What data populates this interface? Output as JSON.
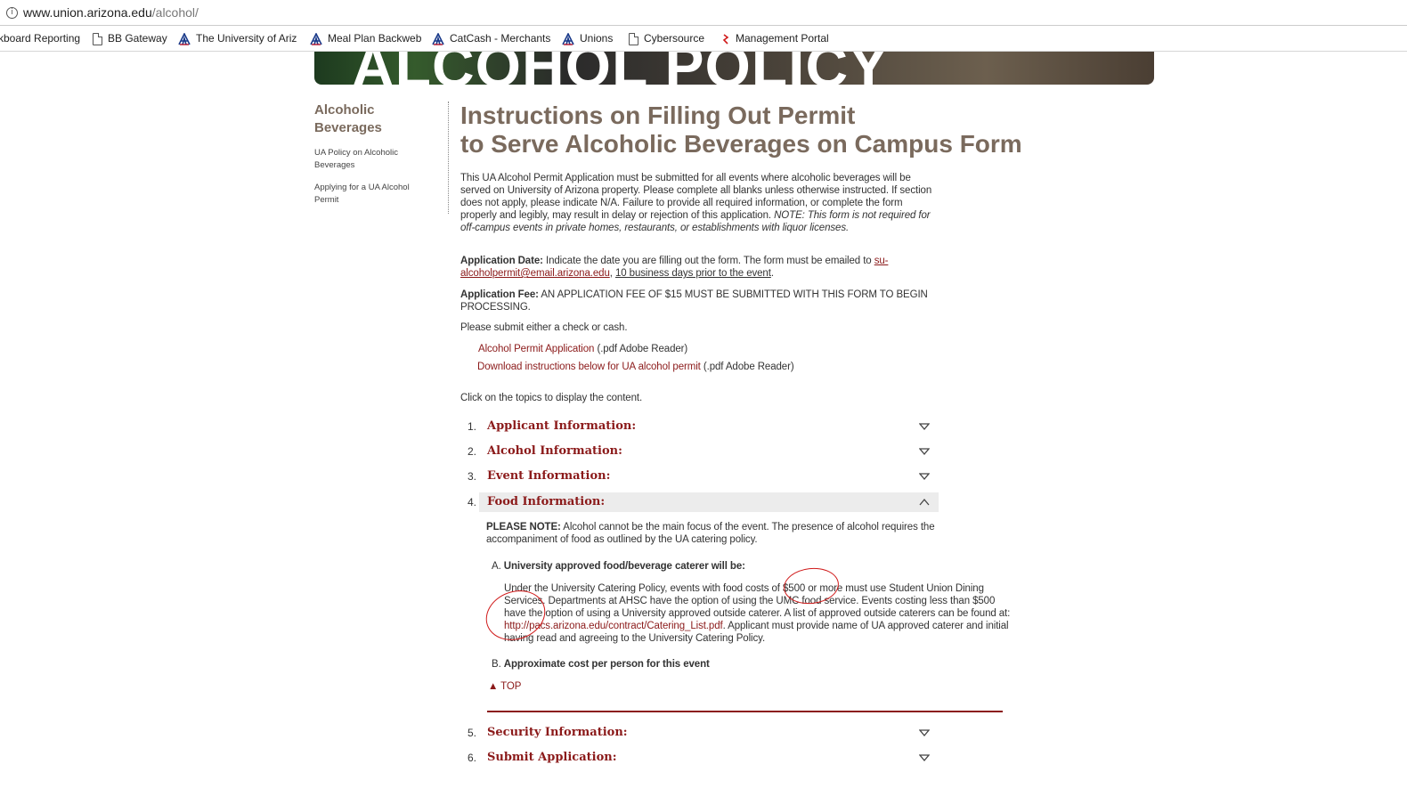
{
  "browser": {
    "url_host": "www.union.arizona.edu",
    "url_path": "/alcohol/",
    "bookmarks": [
      {
        "label": "kboard Reporting",
        "icon": "none"
      },
      {
        "label": "BB Gateway",
        "icon": "doc-icon"
      },
      {
        "label": "The University of Ariz",
        "icon": "ua-logo-icon"
      },
      {
        "label": "Meal Plan Backweb",
        "icon": "ua-logo-icon"
      },
      {
        "label": "CatCash - Merchants",
        "icon": "ua-logo-icon"
      },
      {
        "label": "Unions",
        "icon": "ua-logo-icon"
      },
      {
        "label": "Cybersource",
        "icon": "doc-icon"
      },
      {
        "label": "Management Portal",
        "icon": "management-icon"
      }
    ]
  },
  "banner": {
    "title": "ALCOHOL POLICY"
  },
  "sidebar": {
    "title": "Alcoholic Beverages",
    "links": [
      "UA Policy on Alcoholic Beverages",
      "Applying for a UA Alcohol Permit"
    ]
  },
  "main": {
    "title_line1": "Instructions on Filling Out Permit",
    "title_line2": "to Serve Alcoholic Beverages on Campus Form",
    "intro": "This UA Alcohol Permit Application must be submitted for all events where alcoholic beverages will be served on University of Arizona property. Please complete all blanks unless otherwise instructed. If section does not apply, please indicate N/A. Failure to provide all required information, or complete the form properly and legibly, may result in delay or rejection of this application.",
    "intro_note": "NOTE: This form is not required for off-campus events in private homes, restaurants, or establishments with liquor licenses.",
    "app_date_label": "Application Date:",
    "app_date_text": "Indicate the date you are filling out the form. The form must be emailed to",
    "app_date_email": "su-alcoholpermit@email.arizona.edu",
    "app_date_sep": ",",
    "app_date_deadline": "10 business days prior to the event",
    "app_date_end": ".",
    "app_fee_label": "Application Fee:",
    "app_fee_text": "AN APPLICATION FEE OF $15 MUST BE SUBMITTED WITH THIS FORM TO BEGIN PROCESSING.",
    "payment_text": "Please submit either a check or cash.",
    "downloads": [
      {
        "link": "Alcohol Permit Application",
        "suffix": "(.pdf Adobe Reader)"
      },
      {
        "link": "Download instructions below for UA alcohol permit",
        "suffix": "(.pdf Adobe Reader)"
      }
    ],
    "click_text": "Click on the topics to display the content."
  },
  "sections": [
    {
      "num": "1.",
      "label": "Applicant Information:",
      "open": false
    },
    {
      "num": "2.",
      "label": "Alcohol Information:",
      "open": false
    },
    {
      "num": "3.",
      "label": "Event Information:",
      "open": false
    },
    {
      "num": "4.",
      "label": "Food Information:",
      "open": true
    },
    {
      "num": "5.",
      "label": "Security Information:",
      "open": false
    },
    {
      "num": "6.",
      "label": "Submit Application:",
      "open": false
    }
  ],
  "food": {
    "note_label": "PLEASE NOTE:",
    "note_text": "Alcohol cannot be the main focus of the event. The presence of alcohol requires the accompaniment of food as outlined by the UA catering policy.",
    "a_marker": "A.",
    "a_heading": "University approved food/beverage caterer will be:",
    "a_text_1": "Under the University Catering Policy, events with food costs of $500 or more must use Student Union Dining Services. Departments at AHSC have the option of using the UMC food service. Events costing less than $500 have the option of using a University approved outside caterer. A list of approved outside caterers can be found at:",
    "a_link": "http://pacs.arizona.edu/contract/Catering_List.pdf",
    "a_text_2": ". Applicant must provide name of UA approved caterer and initial having read and agreeing to the University Catering Policy.",
    "b_marker": "B.",
    "b_heading": "Approximate cost per person for this event",
    "top_link": "▲ TOP"
  },
  "colors": {
    "accent": "#8b1a1a",
    "heading": "#7a6a5d",
    "annotation": "#d01a1a"
  }
}
